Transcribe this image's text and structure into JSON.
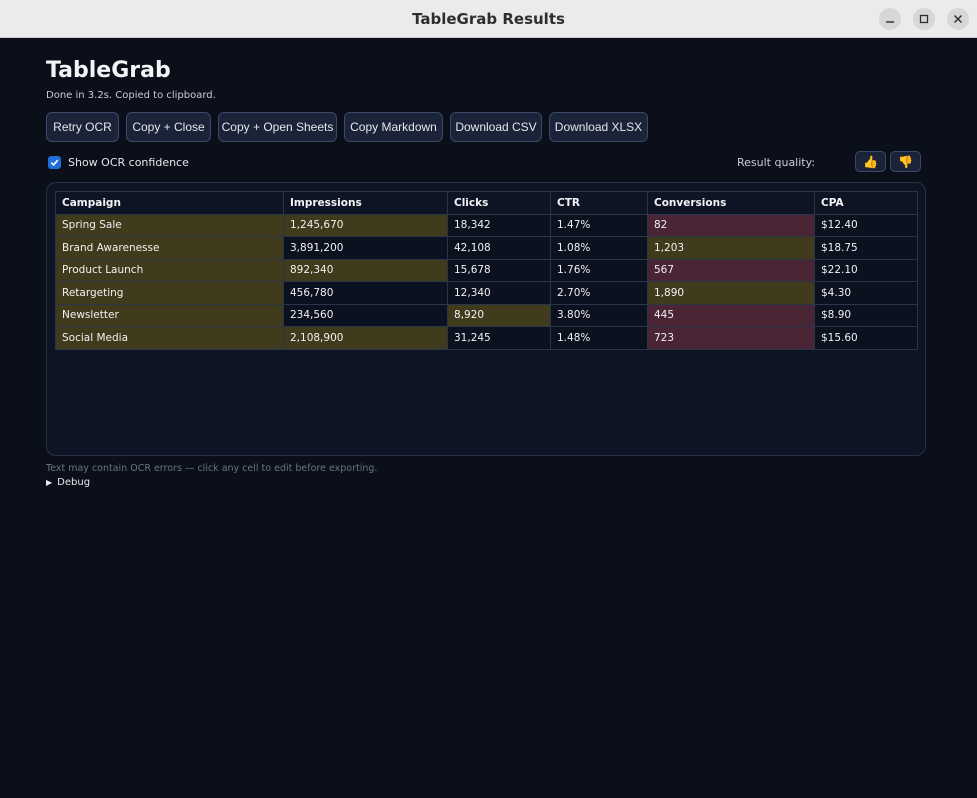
{
  "window": {
    "title": "TableGrab Results"
  },
  "app": {
    "title": "TableGrab",
    "status": "Done in 3.2s. Copied to clipboard."
  },
  "toolbar": {
    "retry_ocr": "Retry OCR",
    "copy_close": "Copy + Close",
    "copy_open_sheets": "Copy + Open Sheets",
    "copy_markdown": "Copy Markdown",
    "download_csv": "Download CSV",
    "download_xlsx": "Download XLSX"
  },
  "confidence": {
    "label": "Show OCR confidence",
    "checked": true
  },
  "quality": {
    "label": "Result quality:",
    "thumbs_up": "👍",
    "thumbs_down": "👎"
  },
  "table": {
    "headers": [
      "Campaign",
      "Impressions",
      "Clicks",
      "CTR",
      "Conversions",
      "CPA"
    ],
    "rows": [
      [
        "Spring Sale",
        "1,245,670",
        "18,342",
        "1.47%",
        "82",
        "$12.40"
      ],
      [
        "Brand Awarenesse",
        "3,891,200",
        "42,108",
        "1.08%",
        "1,203",
        "$18.75"
      ],
      [
        "Product Launch",
        "892,340",
        "15,678",
        "1.76%",
        "567",
        "$22.10"
      ],
      [
        "Retargeting",
        "456,780",
        "12,340",
        "2.70%",
        "1,890",
        "$4.30"
      ],
      [
        "Newsletter",
        "234,560",
        "8,920",
        "3.80%",
        "445",
        "$8.90"
      ],
      [
        "Social Media",
        "2,108,900",
        "31,245",
        "1.48%",
        "723",
        "$15.60"
      ]
    ],
    "low_confidence_colors": {
      "medium": "#3f3b1c",
      "low": "#4a2536"
    }
  },
  "footnote": "Text may contain OCR errors — click any cell to edit before exporting.",
  "debug": {
    "label": "Debug"
  },
  "colors": {
    "background": "#0b0f1a",
    "button_border": "#3a4a6b",
    "button_bg": "#1a2338",
    "checkbox_accent": "#1e6fd9"
  }
}
